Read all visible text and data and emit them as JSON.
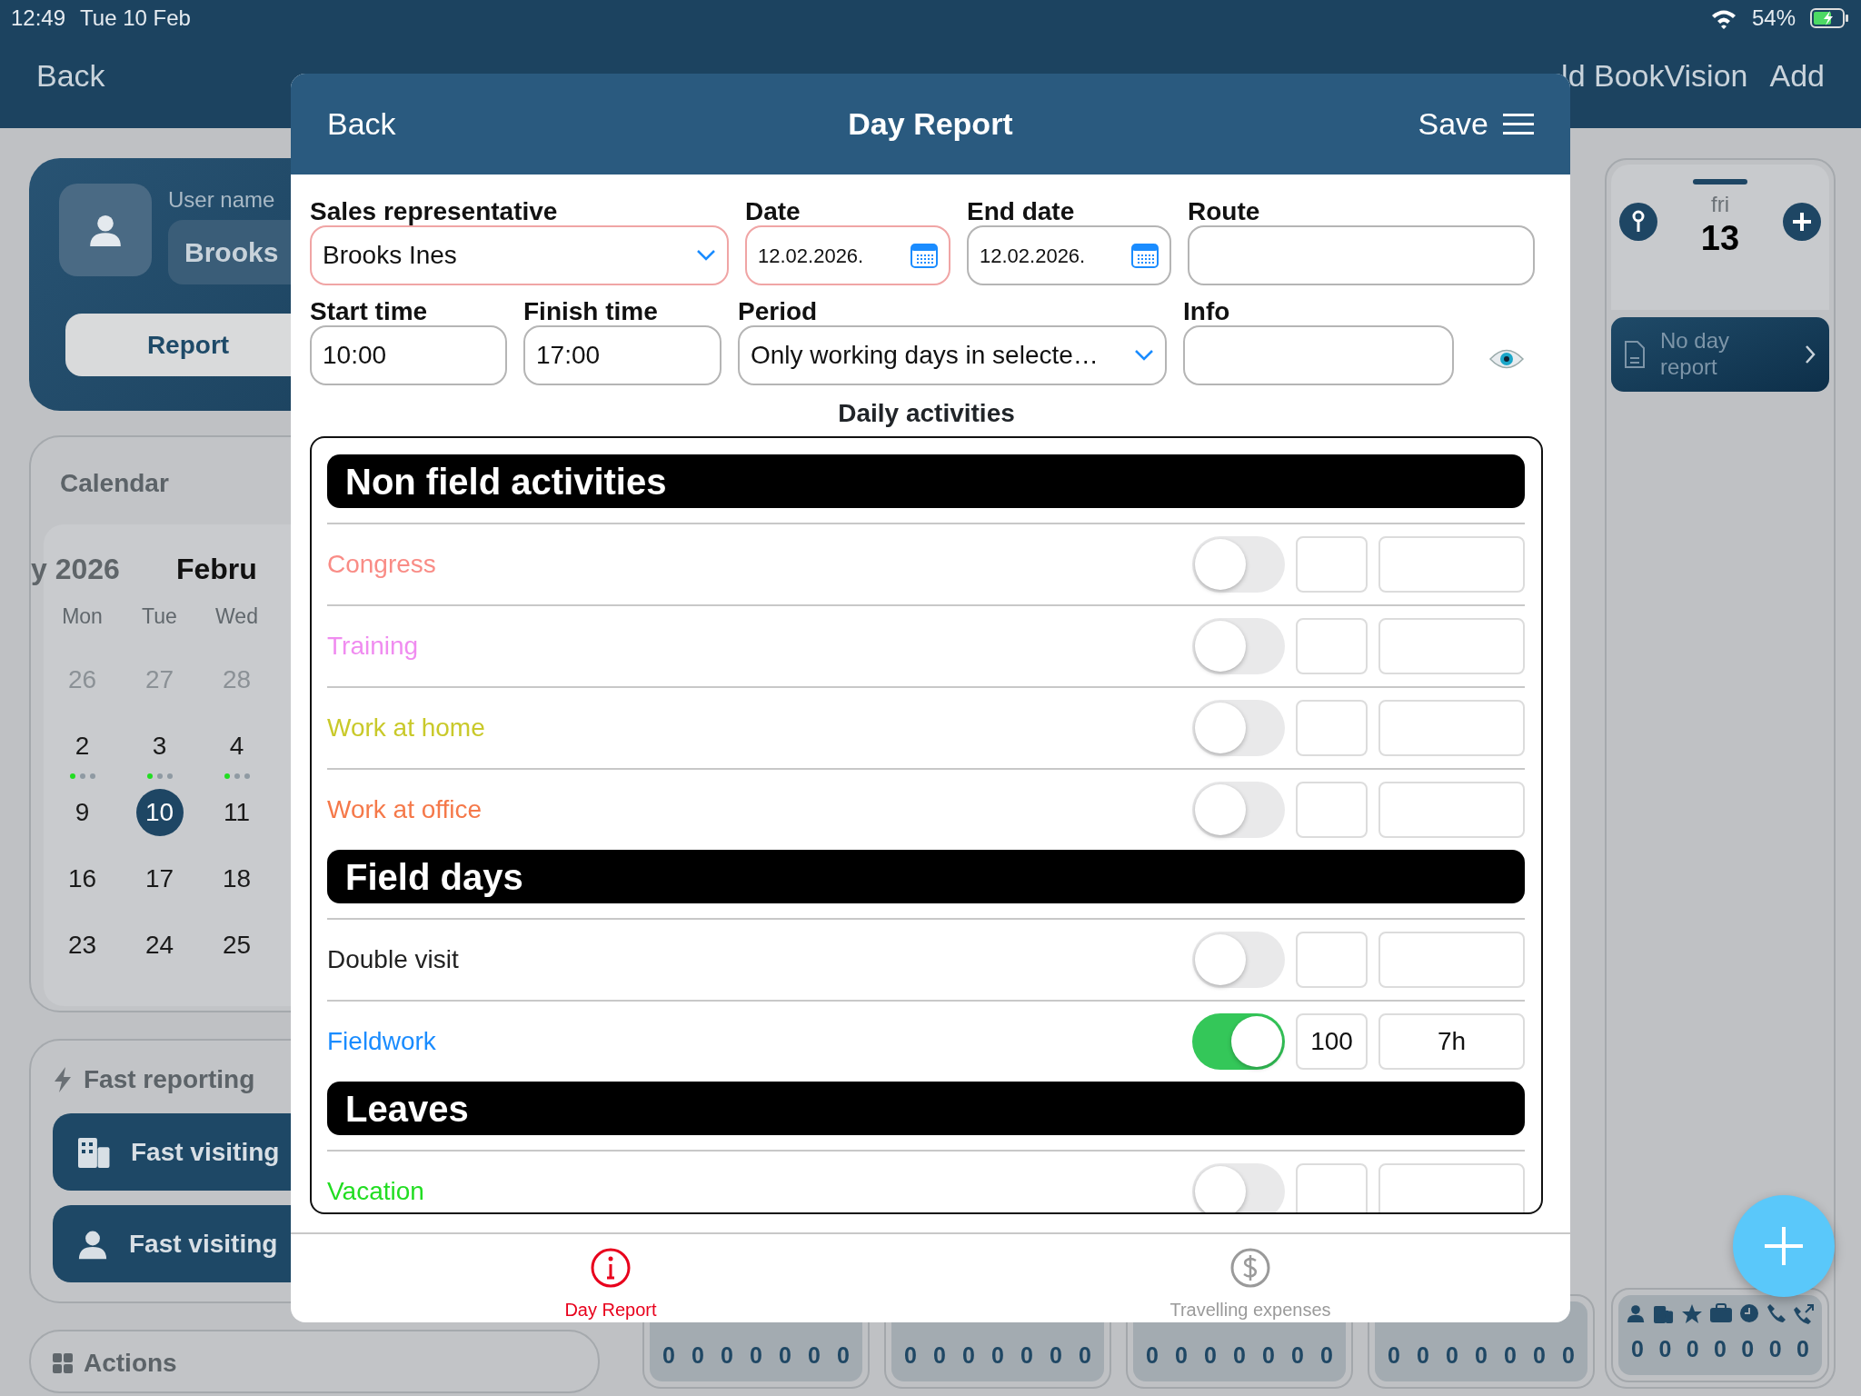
{
  "status_bar": {
    "time": "12:49",
    "date": "Tue 10 Feb",
    "battery": "54%"
  },
  "app_bar": {
    "back": "Back",
    "title_fragment": "ld BookVision",
    "add": "Add"
  },
  "user_card": {
    "label": "User name",
    "name": "Brooks",
    "report_button": "Report"
  },
  "calendar": {
    "title": "Calendar",
    "prev_month": "y 2026",
    "month": "Febru",
    "weekdays": [
      "Mon",
      "Tue",
      "Wed"
    ],
    "weeks": [
      [
        {
          "day": "26",
          "other_month": true,
          "selected": false
        },
        {
          "day": "27",
          "other_month": true,
          "selected": false
        },
        {
          "day": "28",
          "other_month": true,
          "selected": false
        }
      ],
      [
        {
          "day": "2",
          "other_month": false,
          "selected": false,
          "dots": [
            {
              "color": "#22dd22"
            },
            {
              "color": "#8f9aa3"
            },
            {
              "color": "#8f9aa3"
            }
          ]
        },
        {
          "day": "3",
          "other_month": false,
          "selected": false,
          "dots": [
            {
              "color": "#22dd22"
            },
            {
              "color": "#8f9aa3"
            },
            {
              "color": "#8f9aa3"
            }
          ]
        },
        {
          "day": "4",
          "other_month": false,
          "selected": false,
          "dots": [
            {
              "color": "#22dd22"
            },
            {
              "color": "#8f9aa3"
            },
            {
              "color": "#8f9aa3"
            }
          ]
        }
      ],
      [
        {
          "day": "9",
          "other_month": false,
          "selected": false
        },
        {
          "day": "10",
          "other_month": false,
          "selected": true
        },
        {
          "day": "11",
          "other_month": false,
          "selected": false
        }
      ],
      [
        {
          "day": "16",
          "other_month": false,
          "selected": false
        },
        {
          "day": "17",
          "other_month": false,
          "selected": false
        },
        {
          "day": "18",
          "other_month": false,
          "selected": false
        }
      ],
      [
        {
          "day": "23",
          "other_month": false,
          "selected": false
        },
        {
          "day": "24",
          "other_month": false,
          "selected": false
        },
        {
          "day": "25",
          "other_month": false,
          "selected": false
        }
      ]
    ]
  },
  "fast_reporting": {
    "title": "Fast reporting",
    "items": [
      {
        "label": "Fast visiting",
        "kind": "building"
      },
      {
        "label": "Fast visiting",
        "kind": "person"
      }
    ]
  },
  "actions": {
    "title": "Actions"
  },
  "day_column": {
    "weekday": "fri",
    "day": "13",
    "report": "No day report"
  },
  "counters": [
    {
      "icons_visible": false,
      "values": [
        "0",
        "0",
        "0",
        "0",
        "0",
        "0",
        "0"
      ]
    },
    {
      "icons_visible": false,
      "values": [
        "0",
        "0",
        "0",
        "0",
        "0",
        "0",
        "0"
      ]
    },
    {
      "icons_visible": false,
      "values": [
        "0",
        "0",
        "0",
        "0",
        "0",
        "0",
        "0"
      ]
    },
    {
      "icons_visible": false,
      "values": [
        "0",
        "0",
        "0",
        "0",
        "0",
        "0",
        "0"
      ]
    },
    {
      "icons_visible": true,
      "values": [
        "0",
        "0",
        "0",
        "0",
        "0",
        "0",
        "0"
      ]
    }
  ],
  "modal": {
    "back": "Back",
    "title": "Day Report",
    "save": "Save",
    "fields": [
      {
        "label": "Sales representative",
        "value": "Brooks Ines",
        "kind": "select",
        "invalid": true
      },
      {
        "label": "Date",
        "value": "12.02.2026.",
        "kind": "date",
        "invalid": true
      },
      {
        "label": "End date",
        "value": "12.02.2026.",
        "kind": "date",
        "invalid": false
      },
      {
        "label": "Route",
        "kind": "text",
        "invalid": false
      },
      {
        "label": "Start time",
        "value": "10:00",
        "kind": "text",
        "invalid": false
      },
      {
        "label": "Finish time",
        "value": "17:00",
        "kind": "text",
        "invalid": false
      },
      {
        "label": "Period",
        "value": "Only working days in selecte…",
        "kind": "select",
        "invalid": false
      },
      {
        "label": "Info",
        "kind": "info",
        "invalid": false
      }
    ],
    "activities_title": "Daily activities",
    "sections": [
      {
        "title": "Non field activities",
        "items": [
          {
            "label": "Congress",
            "color": "#f98c86",
            "on": false
          },
          {
            "label": "Training",
            "color": "#f08cf0",
            "on": false
          },
          {
            "label": "Work at home",
            "color": "#c9c92a",
            "on": false
          },
          {
            "label": "Work at office",
            "color": "#f5794a",
            "on": false
          }
        ]
      },
      {
        "title": "Field days",
        "items": [
          {
            "label": "Double visit",
            "color": "#222222",
            "on": false
          },
          {
            "label": "Fieldwork",
            "color": "#1a8cff",
            "on": true,
            "percent": "100",
            "hours": "7h"
          }
        ]
      },
      {
        "title": "Leaves",
        "items": [
          {
            "label": "Vacation",
            "color": "#22dd22",
            "on": false
          }
        ]
      }
    ],
    "tabs": [
      {
        "label": "Day Report",
        "kind": "info",
        "selected": true
      },
      {
        "label": "Travelling expenses",
        "kind": "dollar",
        "selected": false
      }
    ]
  }
}
